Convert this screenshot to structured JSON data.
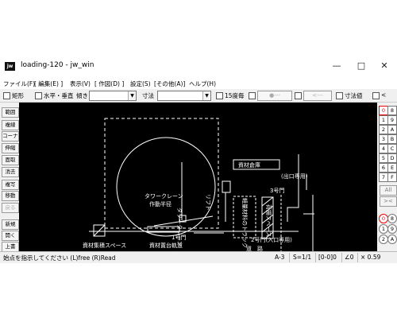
{
  "window": {
    "title": "loading-120 - jw_win",
    "app_icon": "jw"
  },
  "menu": [
    "ファイル(F)",
    "[ 編集(E) ]",
    "表示(V)",
    "[ 作図(D) ]",
    "設定(S)",
    "[その他(A)]",
    "ヘルプ(H)"
  ],
  "toolbar": {
    "rect": "矩形",
    "hv": "水平・垂直",
    "tilt": "傾き",
    "dim": "寸法",
    "deg15": "15度毎",
    "btn_a": "●---",
    "btn_b": "<---",
    "dimval": "寸法値",
    "lt": "<"
  },
  "left_buttons": [
    "範囲",
    "複線",
    "コーナー",
    "伸縮",
    "面取",
    "消去",
    "複写",
    "移動",
    "戻る",
    "新規",
    "開く",
    "上書"
  ],
  "right_buttons": {
    "layers_top": [
      "0",
      "8",
      "1",
      "9",
      "2",
      "A",
      "3",
      "B",
      "4",
      "C",
      "5",
      "D",
      "6",
      "E",
      "7",
      "F"
    ],
    "all": "All",
    "x": "><",
    "layers_bottom": [
      "0",
      "8",
      "1",
      "9",
      "2",
      "A"
    ]
  },
  "drawing": {
    "labels": {
      "tower_crane_radius_1": "タワークレーン",
      "tower_crane_radius_2": "作動半径",
      "tower_crane": "タワークレーン",
      "lift": "リフト",
      "material_storage": "資材倉庫",
      "exit": "(出口専用)",
      "gate3": "3号門",
      "unload_space_v": "荷揚スペース",
      "truck_v": "軽量材料のトラック",
      "gate2": "2号門(入口専用)",
      "road": "道　路",
      "gate1": "1号門",
      "material_yard": "資材集積スペース",
      "cargo_platform": "資材置台軌道"
    }
  },
  "status": {
    "message": "始点を指示してください (L)free (R)Read",
    "paper": "A-3",
    "scale": "S=1/1",
    "layer": "[0-0]0",
    "angle": "∠0",
    "zoom": "× 0.59"
  }
}
